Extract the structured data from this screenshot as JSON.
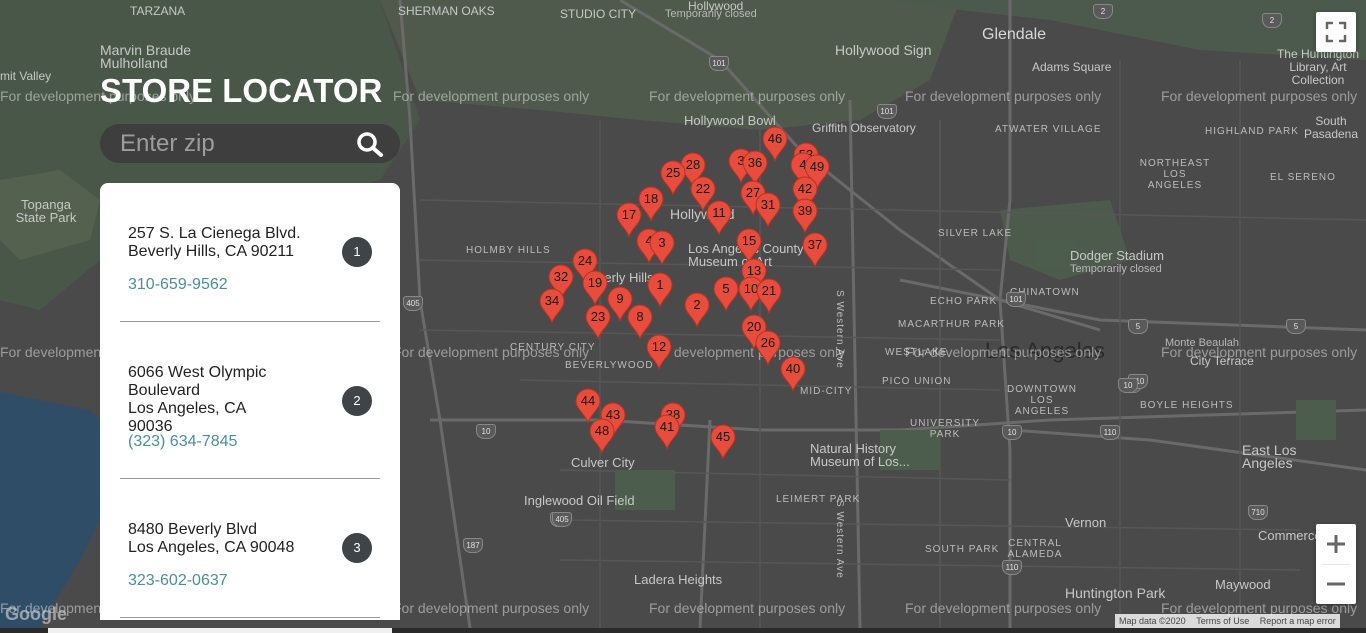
{
  "header": {
    "title": "STORE LOCATOR"
  },
  "search": {
    "placeholder": "Enter zip",
    "icon": "search-icon"
  },
  "stores": [
    {
      "address_line1": "257 S. La Cienega Blvd.",
      "address_line2": "Beverly Hills, CA 90211",
      "phone": "310-659-9562",
      "number": "1"
    },
    {
      "address_line1": "6066 West Olympic Boulevard",
      "address_line2": "Los Angeles, CA 90036",
      "phone": "(323) 634-7845",
      "number": "2"
    },
    {
      "address_line1": "8480 Beverly Blvd",
      "address_line2": "Los Angeles, CA 90048",
      "phone": "323-602-0637",
      "number": "3"
    }
  ],
  "map": {
    "watermark": "For development purposes only",
    "places": {
      "tarzana": "TARZANA",
      "sherman_oaks": "SHERMAN OAKS",
      "studio_city": "STUDIO CITY",
      "hollywood_top": "Hollywood",
      "temporarily_closed": "Temporarily closed",
      "glendale": "Glendale",
      "marvin_braude": "Marvin Braude Mulholland",
      "mit_valley": "mit Valley",
      "hollywood_sign": "Hollywood Sign",
      "adams_square": "Adams Square",
      "huntington": "The Huntington Library, Art Collection",
      "pasadena": "South Pasadena",
      "hollywood_bowl": "Hollywood Bowl",
      "griffith": "Griffith Observatory",
      "highland_park": "HIGHLAND PARK",
      "atwater": "ATWATER VILLAGE",
      "northeast_la": "NORTHEAST LOS ANGELES",
      "el_sereno": "EL SERENO",
      "topanga": "Topanga State Park",
      "holmby": "HOLMBY HILLS",
      "silver_lake": "SILVER LAKE",
      "echo_park": "ECHO PARK",
      "dodger": "Dodger Stadium",
      "lacma": "Los Angeles County Museum of Art",
      "macarthur": "MACARTHUR PARK",
      "chinatown": "CHINATOWN",
      "westlake": "WESTLAKE",
      "los_angeles": "Los Angeles",
      "city_terrace": "City Terrace",
      "monte_beaulah": "Monte Beaulah",
      "century_city": "CENTURY CITY",
      "beverlywood": "BEVERLYWOOD",
      "mid_city": "MID-CITY",
      "pico_union": "PICO UNION",
      "downtown": "DOWNTOWN LOS ANGELES",
      "boyle": "BOYLE HEIGHTS",
      "culver_city": "Culver City",
      "university_park": "UNIVERSITY PARK",
      "natural_history": "Natural History Museum of Los...",
      "east_la": "East Los Angeles",
      "inglewood_oil": "Inglewood Oil Field",
      "leimert": "LEIMERT PARK",
      "vernon": "Vernon",
      "south_park": "SOUTH PARK",
      "central_alameda": "CENTRAL ALAMEDA",
      "commerce": "Commerce",
      "ladera": "Ladera Heights",
      "maywood": "Maywood",
      "huntington_park": "Huntington Park",
      "western_ave": "S Western Ave",
      "beverly_hills": "Beverly Hills",
      "hollywood_mid": "Hollywood"
    },
    "pins": [
      {
        "label": "46"
      },
      {
        "label": "53"
      },
      {
        "label": "3"
      },
      {
        "label": "36"
      },
      {
        "label": "28"
      },
      {
        "label": "4"
      },
      {
        "label": "49"
      },
      {
        "label": "25"
      },
      {
        "label": "22"
      },
      {
        "label": "27"
      },
      {
        "label": "42"
      },
      {
        "label": "18"
      },
      {
        "label": "31"
      },
      {
        "label": "17"
      },
      {
        "label": "11"
      },
      {
        "label": "39"
      },
      {
        "label": "4"
      },
      {
        "label": "3"
      },
      {
        "label": "15"
      },
      {
        "label": "37"
      },
      {
        "label": "24"
      },
      {
        "label": "32"
      },
      {
        "label": "19"
      },
      {
        "label": "13"
      },
      {
        "label": "1"
      },
      {
        "label": "5"
      },
      {
        "label": "10"
      },
      {
        "label": "21"
      },
      {
        "label": "34"
      },
      {
        "label": "9"
      },
      {
        "label": "2"
      },
      {
        "label": "23"
      },
      {
        "label": "8"
      },
      {
        "label": "20"
      },
      {
        "label": "26"
      },
      {
        "label": "12"
      },
      {
        "label": "40"
      },
      {
        "label": "44"
      },
      {
        "label": "43"
      },
      {
        "label": "38"
      },
      {
        "label": "48"
      },
      {
        "label": "41"
      },
      {
        "label": "45"
      }
    ],
    "highway_shields": [
      "101",
      "101",
      "2",
      "405",
      "405",
      "10",
      "10",
      "10",
      "10",
      "101",
      "5",
      "110",
      "110",
      "5",
      "710",
      "405",
      "187",
      "110",
      "710",
      "2",
      "10"
    ]
  },
  "controls": {
    "fullscreen_icon": "fullscreen-icon",
    "zoom_in": "+",
    "zoom_out": "−"
  },
  "attribution": {
    "map_data": "Map data ©2020",
    "terms": "Terms of Use",
    "report": "Report a map error",
    "logo": "Google"
  },
  "colors": {
    "pin": "#e74c3c",
    "accent_phone": "#4d8f94",
    "badge": "#3f4448"
  }
}
